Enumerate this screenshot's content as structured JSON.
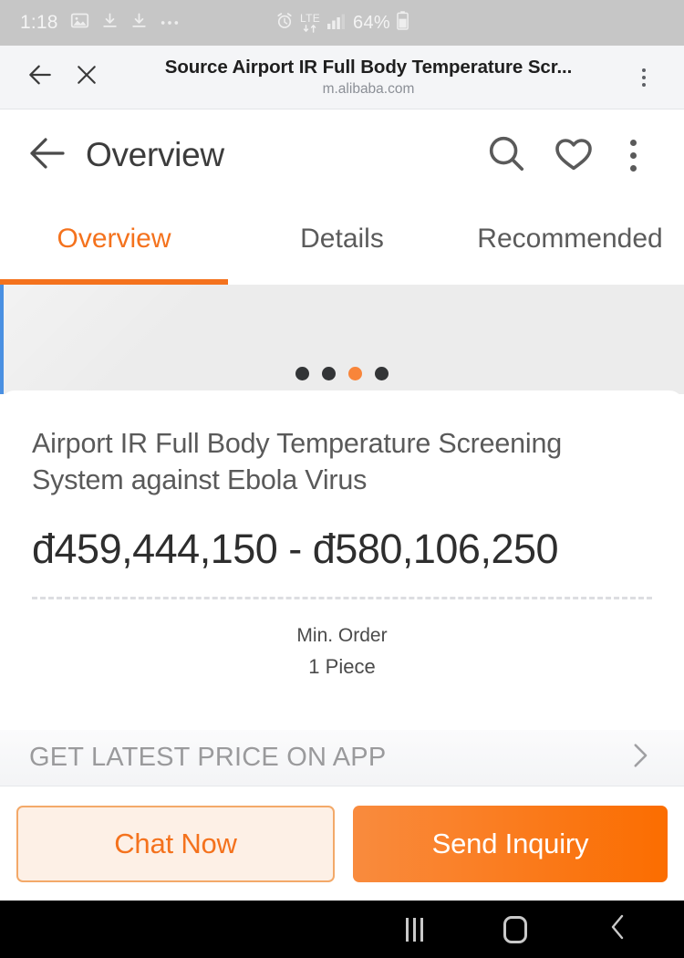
{
  "status_bar": {
    "time": "1:18",
    "left_icons": [
      "image-icon",
      "download-icon",
      "download-icon",
      "ellipsis-icon"
    ],
    "alarm_icon": "alarm-icon",
    "network_type": "LTE",
    "signal_icon": "signal-bars-icon",
    "battery_percent": "64%",
    "battery_icon": "battery-icon"
  },
  "browser_chrome": {
    "back_icon": "back-arrow-icon",
    "close_icon": "close-icon",
    "title": "Source Airport IR Full Body Temperature Scr...",
    "domain": "m.alibaba.com",
    "menu_icon": "overflow-menu-icon"
  },
  "app_header": {
    "back_icon": "back-arrow-icon",
    "title": "Overview",
    "search_icon": "search-icon",
    "favorite_icon": "heart-icon",
    "menu_icon": "overflow-menu-icon"
  },
  "tabs": [
    {
      "label": "Overview",
      "active": true
    },
    {
      "label": "Details",
      "active": false
    },
    {
      "label": "Recommended",
      "active": false
    }
  ],
  "carousel": {
    "dots": 4,
    "active_dot_index": 2
  },
  "product": {
    "title": "Airport IR Full Body Temperature Screening System against Ebola Virus",
    "price": "đ459,444,150 - đ580,106,250",
    "min_order_label": "Min. Order",
    "min_order_value": "1 Piece"
  },
  "promo_band": {
    "text": "GET LATEST PRICE ON APP",
    "chevron_icon": "chevron-right-icon"
  },
  "actions": {
    "chat_label": "Chat Now",
    "inquiry_label": "Send Inquiry"
  },
  "navigation_bar": {
    "recents_icon": "recents-icon",
    "home_icon": "home-icon",
    "back_icon": "back-chevron-icon"
  },
  "colors": {
    "accent_orange": "#f4721d",
    "inquiry_gradient_start": "#f98b3e",
    "inquiry_gradient_end": "#fb6d00",
    "chat_background": "#fdf0e6",
    "status_bar_background": "#c6c6c6"
  }
}
